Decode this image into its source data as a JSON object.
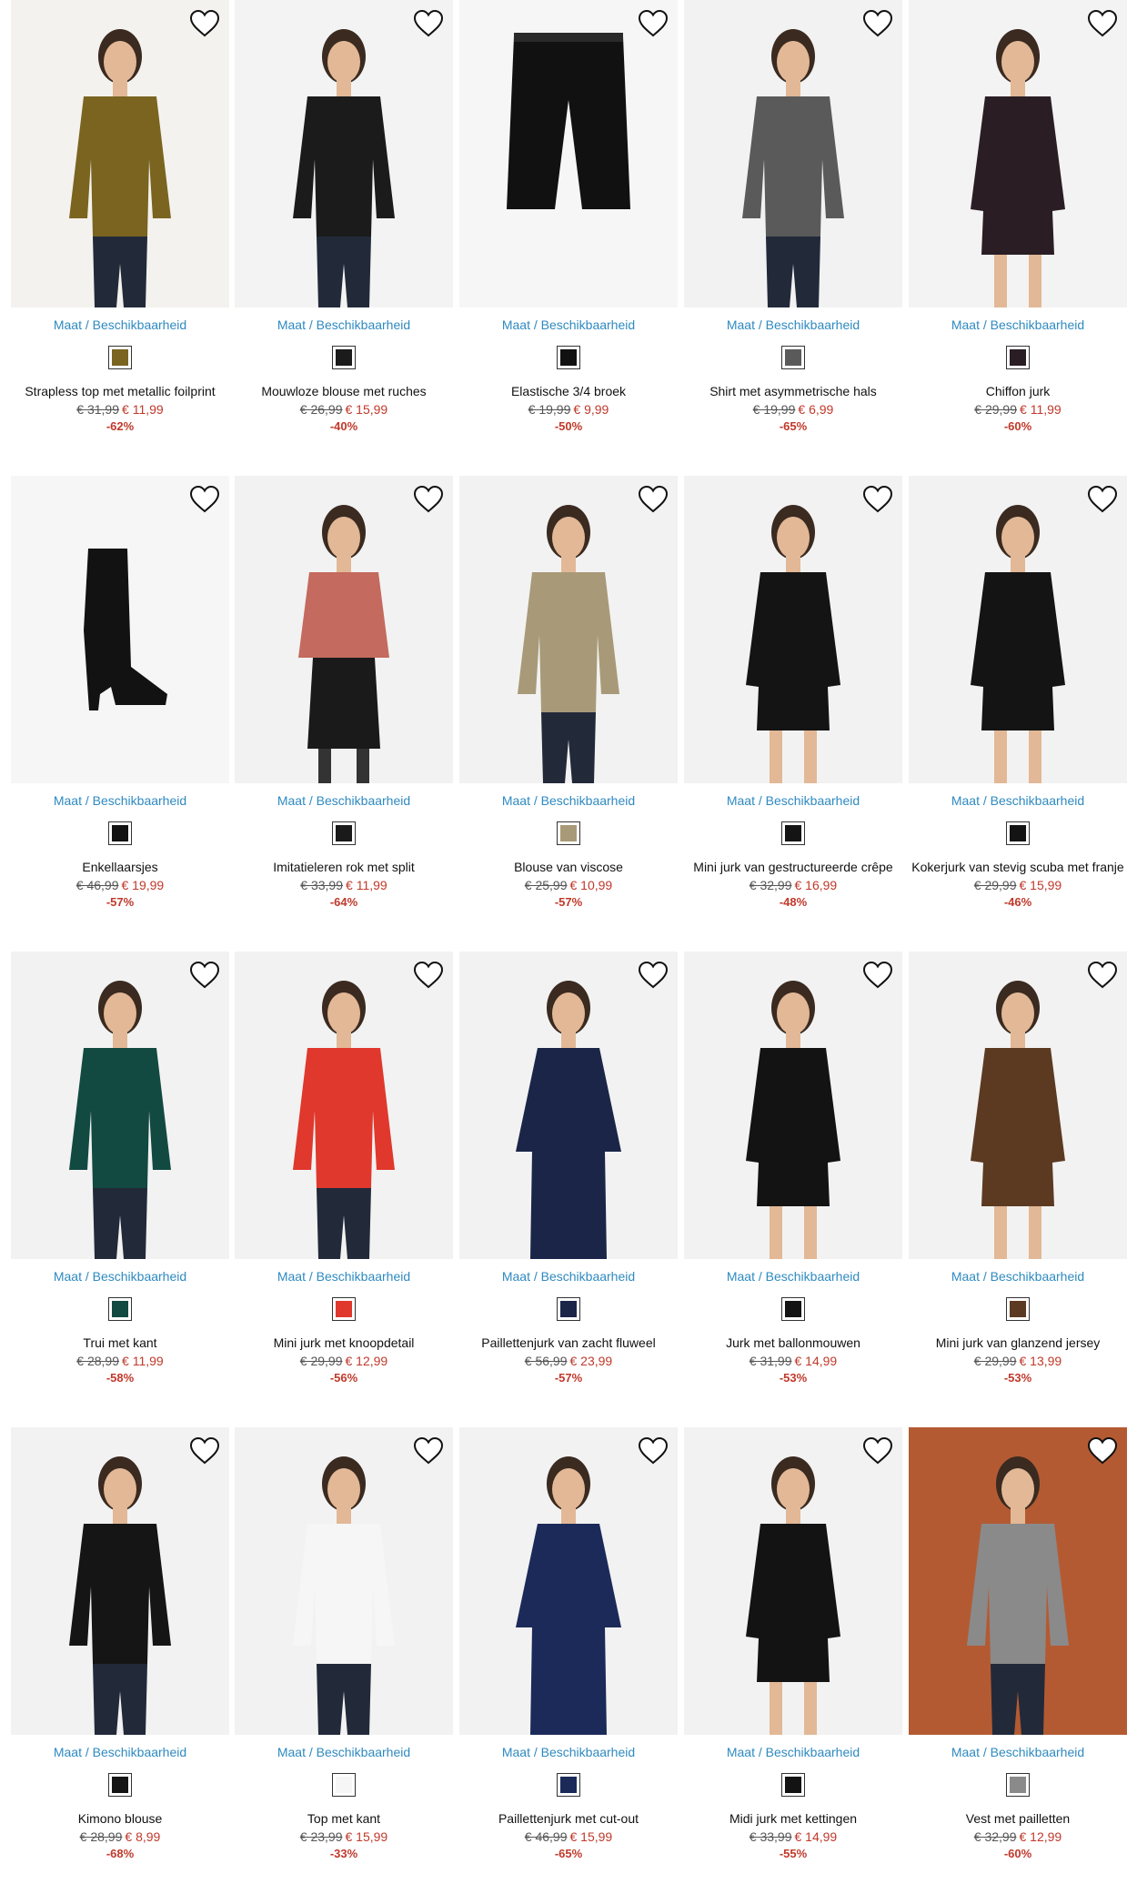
{
  "colors": {
    "link": "#2f8ac0",
    "sale": "#c0392b",
    "text": "#111111"
  },
  "products": [
    {
      "name": "Strapless top met metallic foilprint",
      "old_price": "€ 31,99",
      "new_price": "€ 11,99",
      "discount": "-62%",
      "maat": "Maat / Beschikbaarheid",
      "color": "#7a6420",
      "bg": "#f4f2ee",
      "kind": "top"
    },
    {
      "name": "Mouwloze blouse met ruches",
      "old_price": "€ 26,99",
      "new_price": "€ 15,99",
      "discount": "-40%",
      "maat": "Maat / Beschikbaarheid",
      "color": "#1b1b1b",
      "bg": "#f3f3f3",
      "kind": "top"
    },
    {
      "name": "Elastische 3/4 broek",
      "old_price": "€ 19,99",
      "new_price": "€ 9,99",
      "discount": "-50%",
      "maat": "Maat / Beschikbaarheid",
      "color": "#111111",
      "bg": "#f6f6f6",
      "kind": "pants"
    },
    {
      "name": "Shirt met asymmetrische hals",
      "old_price": "€ 19,99",
      "new_price": "€ 6,99",
      "discount": "-65%",
      "maat": "Maat / Beschikbaarheid",
      "color": "#5a5a5a",
      "bg": "#f2f2f2",
      "kind": "top"
    },
    {
      "name": "Chiffon jurk",
      "old_price": "€ 29,99",
      "new_price": "€ 11,99",
      "discount": "-60%",
      "maat": "Maat / Beschikbaarheid",
      "color": "#2a1e24",
      "bg": "#f3f3f3",
      "kind": "dress"
    },
    {
      "name": "Enkellaarsjes",
      "old_price": "€ 46,99",
      "new_price": "€ 19,99",
      "discount": "-57%",
      "maat": "Maat / Beschikbaarheid",
      "color": "#121212",
      "bg": "#f6f6f6",
      "kind": "boot"
    },
    {
      "name": "Imitatieleren rok met split",
      "old_price": "€ 33,99",
      "new_price": "€ 11,99",
      "discount": "-64%",
      "maat": "Maat / Beschikbaarheid",
      "color": "#1a1a1a",
      "bg": "#f2f2f2",
      "kind": "skirt"
    },
    {
      "name": "Blouse van viscose",
      "old_price": "€ 25,99",
      "new_price": "€ 10,99",
      "discount": "-57%",
      "maat": "Maat / Beschikbaarheid",
      "color": "#a89a78",
      "bg": "#f2f2f2",
      "kind": "top"
    },
    {
      "name": "Mini jurk van gestructureerde crêpe",
      "old_price": "€ 32,99",
      "new_price": "€ 16,99",
      "discount": "-48%",
      "maat": "Maat / Beschikbaarheid",
      "color": "#141414",
      "bg": "#f2f2f2",
      "kind": "dress"
    },
    {
      "name": "Kokerjurk van stevig scuba met franje",
      "old_price": "€ 29,99",
      "new_price": "€ 15,99",
      "discount": "-46%",
      "maat": "Maat / Beschikbaarheid",
      "color": "#141414",
      "bg": "#f2f2f2",
      "kind": "dress"
    },
    {
      "name": "Trui met kant",
      "old_price": "€ 28,99",
      "new_price": "€ 11,99",
      "discount": "-58%",
      "maat": "Maat / Beschikbaarheid",
      "color": "#124a42",
      "bg": "#f2f2f2",
      "kind": "top"
    },
    {
      "name": "Mini jurk met knoopdetail",
      "old_price": "€ 29,99",
      "new_price": "€ 12,99",
      "discount": "-56%",
      "maat": "Maat / Beschikbaarheid",
      "color": "#e0382c",
      "bg": "#f2f2f2",
      "kind": "top"
    },
    {
      "name": "Paillettenjurk van zacht fluweel",
      "old_price": "€ 56,99",
      "new_price": "€ 23,99",
      "discount": "-57%",
      "maat": "Maat / Beschikbaarheid",
      "color": "#1b2548",
      "bg": "#f2f2f2",
      "kind": "gown"
    },
    {
      "name": "Jurk met ballonmouwen",
      "old_price": "€ 31,99",
      "new_price": "€ 14,99",
      "discount": "-53%",
      "maat": "Maat / Beschikbaarheid",
      "color": "#131313",
      "bg": "#f2f2f2",
      "kind": "dress"
    },
    {
      "name": "Mini jurk van glanzend jersey",
      "old_price": "€ 29,99",
      "new_price": "€ 13,99",
      "discount": "-53%",
      "maat": "Maat / Beschikbaarheid",
      "color": "#5c3a22",
      "bg": "#f2f2f2",
      "kind": "dress"
    },
    {
      "name": "Kimono blouse",
      "old_price": "€ 28,99",
      "new_price": "€ 8,99",
      "discount": "-68%",
      "maat": "Maat / Beschikbaarheid",
      "color": "#151515",
      "bg": "#f2f2f2",
      "kind": "top"
    },
    {
      "name": "Top met kant",
      "old_price": "€ 23,99",
      "new_price": "€ 15,99",
      "discount": "-33%",
      "maat": "Maat / Beschikbaarheid",
      "color": "#f6f6f6",
      "bg": "#f2f2f2",
      "kind": "top"
    },
    {
      "name": "Paillettenjurk met cut-out",
      "old_price": "€ 46,99",
      "new_price": "€ 15,99",
      "discount": "-65%",
      "maat": "Maat / Beschikbaarheid",
      "color": "#1c2a5a",
      "bg": "#f2f2f2",
      "kind": "gown"
    },
    {
      "name": "Midi jurk met kettingen",
      "old_price": "€ 33,99",
      "new_price": "€ 14,99",
      "discount": "-55%",
      "maat": "Maat / Beschikbaarheid",
      "color": "#131313",
      "bg": "#f2f2f2",
      "kind": "dress"
    },
    {
      "name": "Vest met pailletten",
      "old_price": "€ 32,99",
      "new_price": "€ 12,99",
      "discount": "-60%",
      "maat": "Maat / Beschikbaarheid",
      "color": "#8a8a8a",
      "bg": "#b45a32",
      "kind": "top"
    }
  ]
}
